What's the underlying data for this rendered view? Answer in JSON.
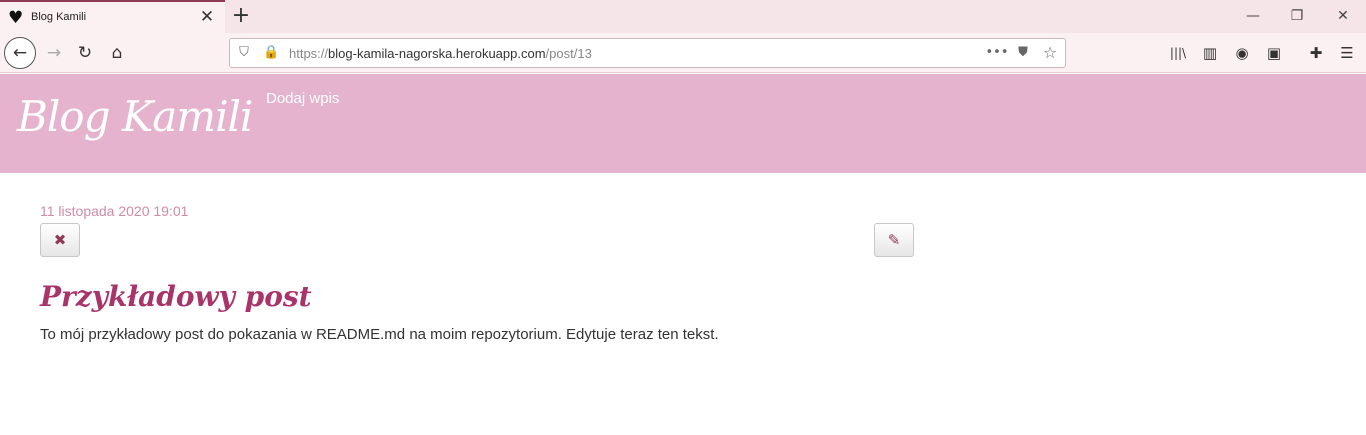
{
  "browser": {
    "tab_title": "Blog Kamili",
    "tab_favicon": "heart-icon",
    "url_prefix": "https://",
    "url_host": "blog-kamila-nagorska.herokuapp.com",
    "url_path": "/post/13",
    "glyphs": {
      "heart": "♥",
      "close": "✕",
      "plus": "+",
      "minimize": "—",
      "restore": "❐",
      "back": "←",
      "forward": "→",
      "reload": "↻",
      "home": "⌂",
      "shield": "⛉",
      "lock": "🔒",
      "more": "•••",
      "pocket": "⛊",
      "star": "☆",
      "library": "|||\\",
      "sidebar": "▥",
      "account": "◉",
      "screenshot": "▣",
      "extension": "✚",
      "menu": "☰"
    }
  },
  "site": {
    "logo": "Blog Kamili",
    "nav_add": "Dodaj wpis"
  },
  "post": {
    "date": "11 listopada 2020 19:01",
    "delete_glyph": "✖",
    "edit_glyph": "✎",
    "title": "Przykładowy post",
    "body": "To mój przykładowy post do pokazania w README.md na moim repozytorium. Edytuje teraz ten tekst."
  },
  "colors": {
    "header_bg": "#e5b3cd",
    "accent": "#a8346a",
    "date": "#d38aa8"
  }
}
